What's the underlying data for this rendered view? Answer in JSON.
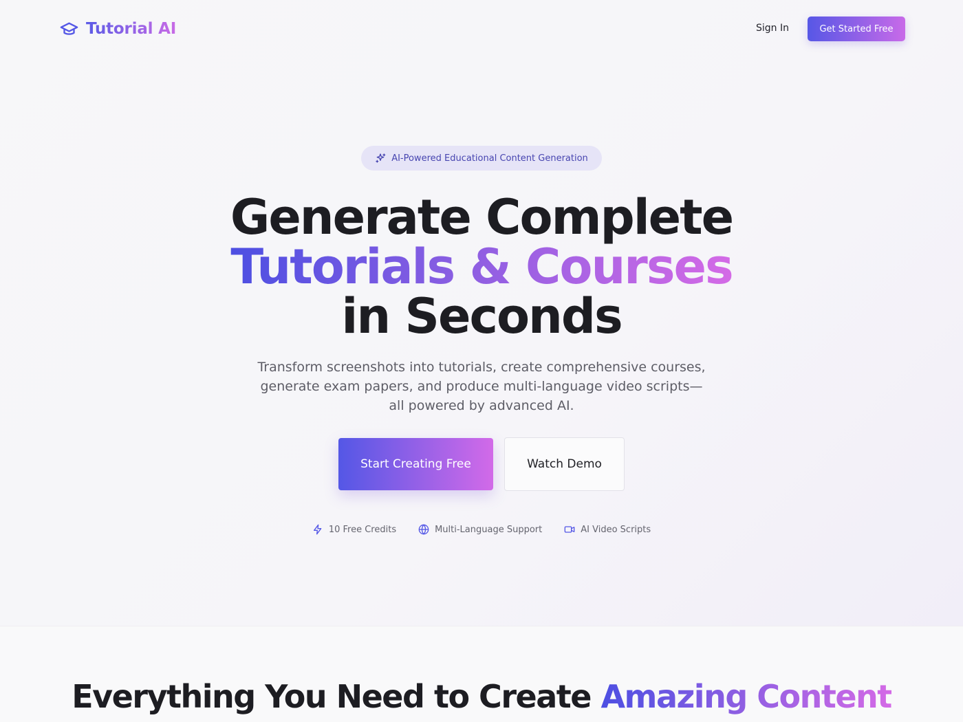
{
  "nav": {
    "brand": "Tutorial AI",
    "sign_in": "Sign In",
    "get_started": "Get Started Free"
  },
  "hero": {
    "badge": "AI-Powered Educational Content Generation",
    "headline_line1": "Generate Complete",
    "headline_line2": "Tutorials & Courses",
    "headline_line3": "in Seconds",
    "subtitle": "Transform screenshots into tutorials, create comprehensive courses, generate exam papers, and produce multi-language video scripts—all powered by advanced AI.",
    "primary_cta": "Start Creating Free",
    "secondary_cta": "Watch Demo",
    "features": [
      {
        "icon": "lightning-icon",
        "label": "10 Free Credits"
      },
      {
        "icon": "globe-icon",
        "label": "Multi-Language Support"
      },
      {
        "icon": "video-icon",
        "label": "AI Video Scripts"
      }
    ]
  },
  "section": {
    "heading_plain": "Everything You Need to Create ",
    "heading_accent": "Amazing Content"
  },
  "colors": {
    "accent_start": "#5457e6",
    "accent_end": "#d26ae8",
    "badge_bg": "#e6e4f7",
    "badge_text": "#4745b0"
  }
}
